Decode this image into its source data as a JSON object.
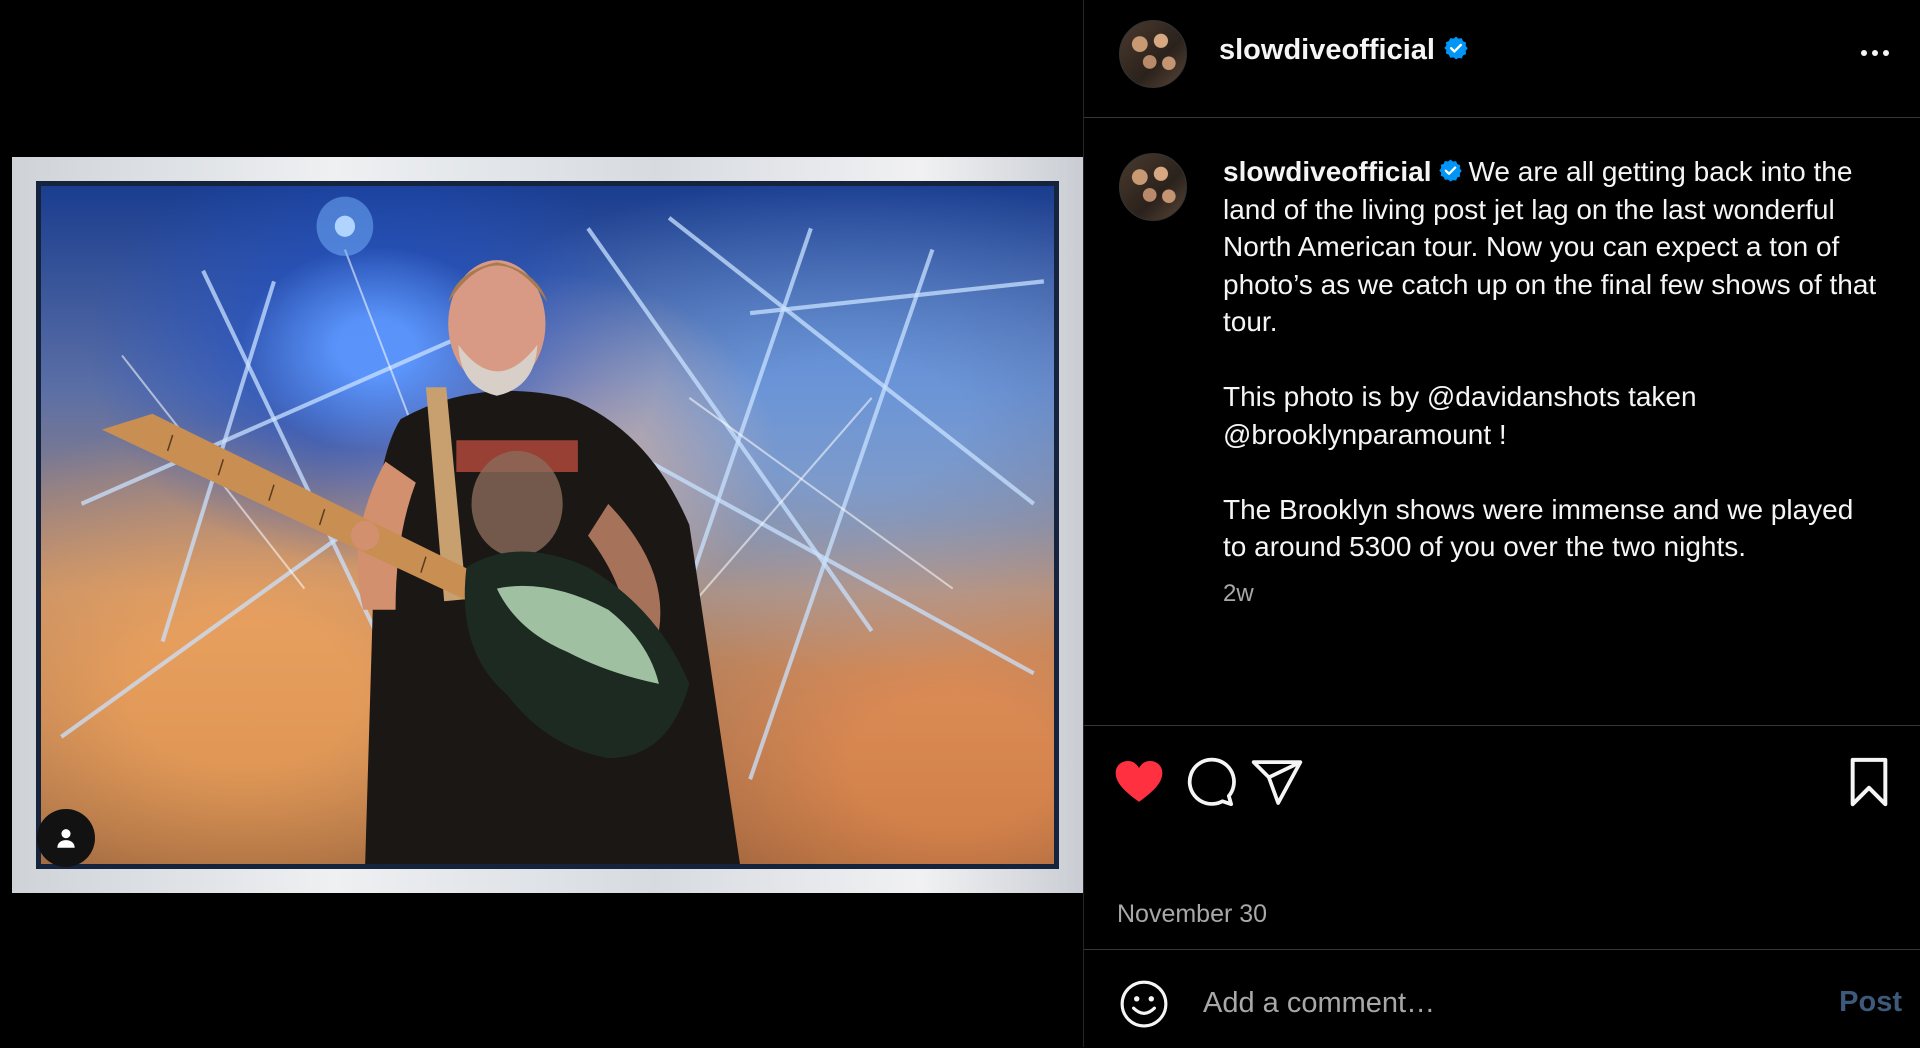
{
  "post": {
    "username": "slowdiveofficial",
    "verified": true,
    "caption_paragraphs": [
      "We are all getting back into the land of the living post jet lag on the last wonderful North American tour. Now you can expect a ton of photo’s as we catch up on the final few shows of that tour.",
      "This photo is by @davidanshots taken @brooklynparamount !",
      "The Brooklyn shows were immense and we played to around 5300 of you over the two nights."
    ],
    "time_ago": "2w",
    "date": "November 30",
    "liked": true
  },
  "icons": {
    "more": "more-horizontal-icon",
    "verified": "verified-badge-icon",
    "like": "heart-icon",
    "comment": "comment-icon",
    "share": "paper-plane-icon",
    "save": "bookmark-icon",
    "emoji": "emoji-icon",
    "tag": "user-tag-icon"
  },
  "colors": {
    "like": "#ff3040",
    "verified": "#0095f6",
    "post_button": "#3e5a7a"
  },
  "comment_box": {
    "placeholder": "Add a comment…",
    "post_label": "Post"
  }
}
